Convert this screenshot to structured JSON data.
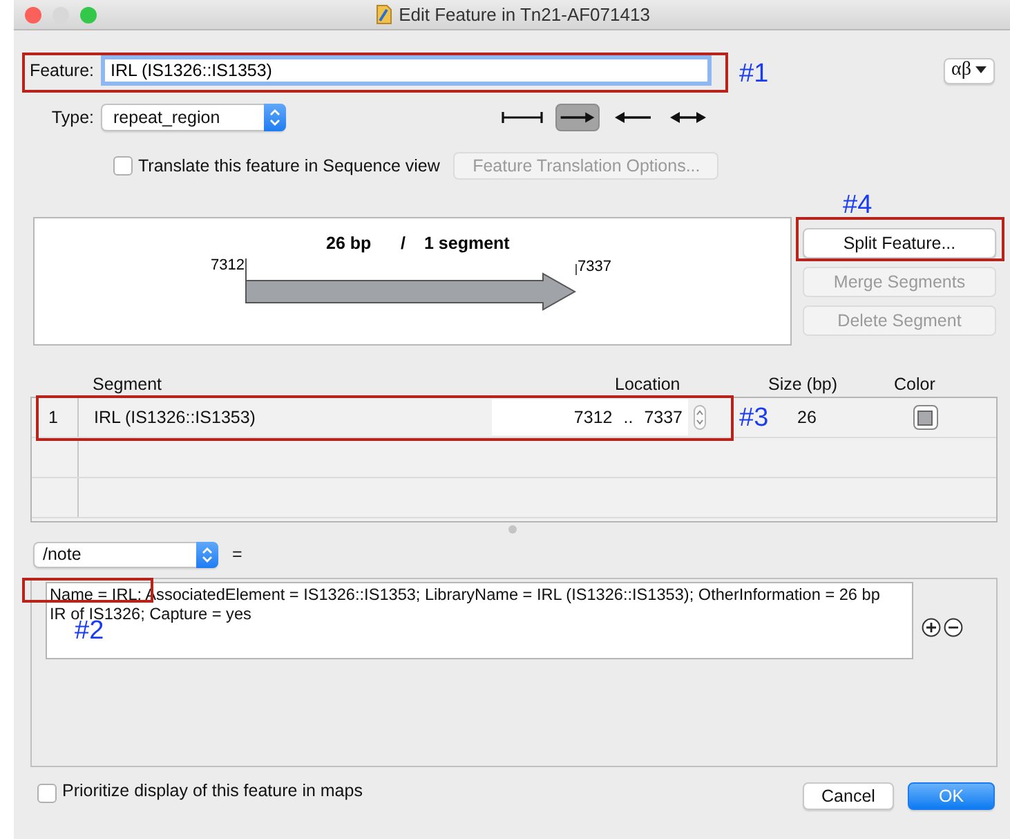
{
  "window": {
    "title": "Edit Feature in Tn21-AF071413"
  },
  "feature": {
    "label": "Feature:",
    "value": "IRL (IS1326::IS1353)"
  },
  "alphabet_button": {
    "label": "αβ"
  },
  "type": {
    "label": "Type:",
    "value": "repeat_region"
  },
  "directions": [
    {
      "kind": "none",
      "selected": false
    },
    {
      "kind": "forward",
      "selected": true
    },
    {
      "kind": "reverse",
      "selected": false
    },
    {
      "kind": "both",
      "selected": false
    }
  ],
  "translate": {
    "label": "Translate this feature in Sequence view",
    "checked": false
  },
  "translation_options_button": {
    "label": "Feature Translation Options...",
    "disabled": true
  },
  "map": {
    "length": "26 bp",
    "separator": "/",
    "segments": "1 segment",
    "start": "7312",
    "end": "7337"
  },
  "segment_buttons": [
    {
      "label": "Split Feature...",
      "disabled": false
    },
    {
      "label": "Merge Segments",
      "disabled": true
    },
    {
      "label": "Delete Segment",
      "disabled": true
    }
  ],
  "segments": {
    "columns": [
      "Segment",
      "Location",
      "Size (bp)",
      "Color"
    ],
    "rows": [
      {
        "index": "1",
        "name": "IRL (IS1326::IS1353)",
        "start": "7312",
        "separator": "..",
        "end": "7337",
        "size": "26",
        "color": "#a7a9ad"
      }
    ]
  },
  "qualifier": {
    "name": "/note",
    "equals": "=",
    "value": "Name = IRL; AssociatedElement = IS1326::IS1353; LibraryName = IRL (IS1326::IS1353); OtherInformation = 26 bp IR of IS1326; Capture = yes"
  },
  "prioritize": {
    "label": "Prioritize display of this feature in maps",
    "checked": false
  },
  "buttons": [
    {
      "label": "Cancel",
      "kind": "default"
    },
    {
      "label": "OK",
      "kind": "primary"
    }
  ],
  "annotations": [
    {
      "label": "#1"
    },
    {
      "label": "#2"
    },
    {
      "label": "#3"
    },
    {
      "label": "#4"
    }
  ]
}
